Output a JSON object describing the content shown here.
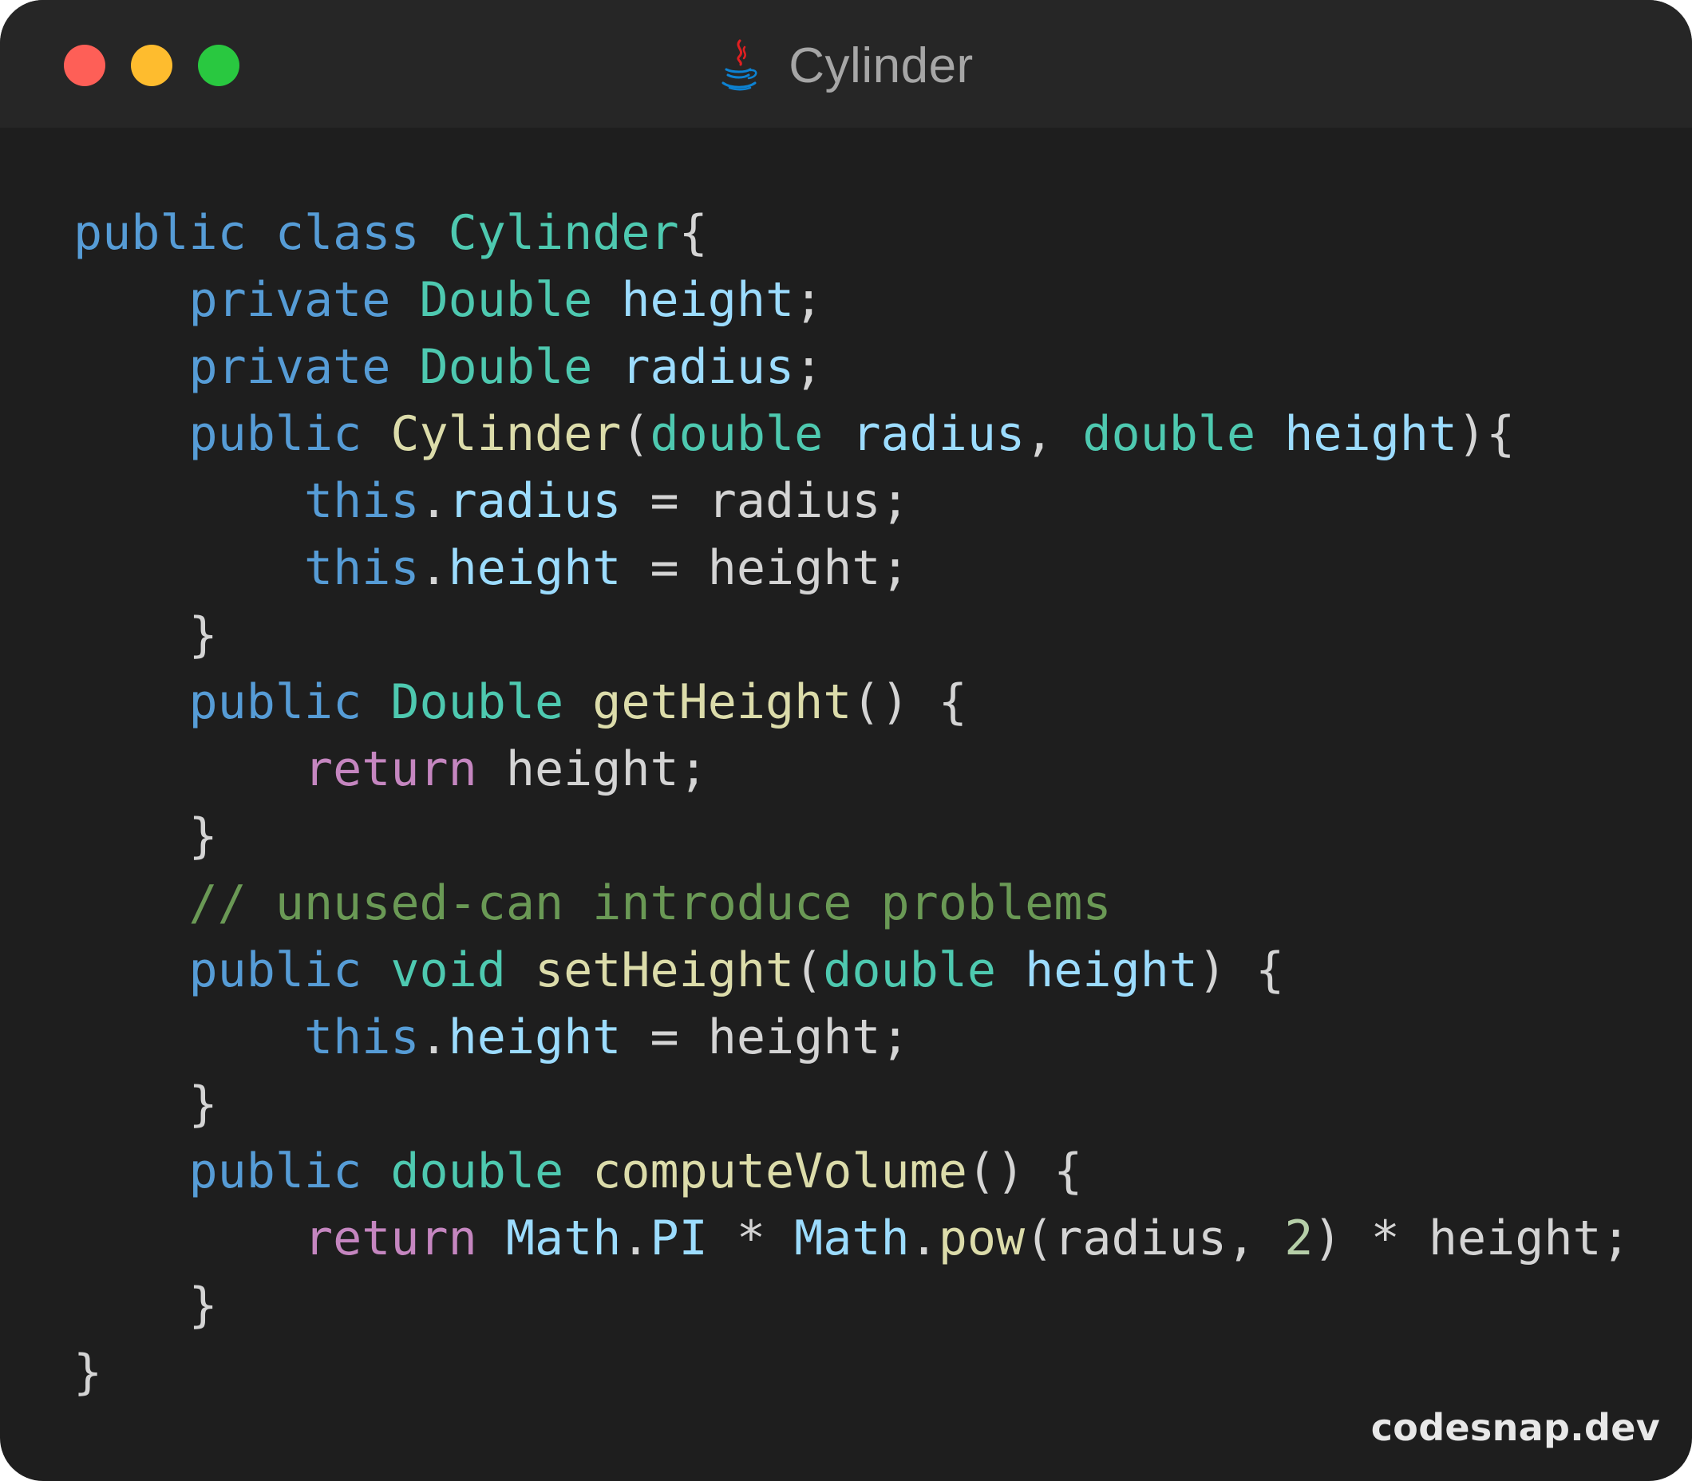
{
  "window": {
    "title": "Cylinder",
    "file_icon": "java-icon",
    "traffic_lights": {
      "close_color": "#fe5f57",
      "minimize_color": "#febc2e",
      "zoom_color": "#29c840"
    }
  },
  "colors": {
    "background": "#1e1e1e",
    "titlebar": "#262626",
    "keyword": "#569cd6",
    "type": "#4ec9b0",
    "variable": "#9cdcfe",
    "function": "#dcdcaa",
    "control": "#c586c0",
    "comment": "#6a9955",
    "number": "#b5cea8",
    "plain": "#d4d4d4"
  },
  "code": {
    "language": "java",
    "lines": [
      [
        {
          "t": "public",
          "k": "kw"
        },
        {
          "t": " ",
          "k": "pl"
        },
        {
          "t": "class",
          "k": "kw"
        },
        {
          "t": " ",
          "k": "pl"
        },
        {
          "t": "Cylinder",
          "k": "type"
        },
        {
          "t": "{",
          "k": "pl"
        }
      ],
      [
        {
          "t": "    ",
          "k": "pl"
        },
        {
          "t": "private",
          "k": "kw"
        },
        {
          "t": " ",
          "k": "pl"
        },
        {
          "t": "Double",
          "k": "type"
        },
        {
          "t": " ",
          "k": "pl"
        },
        {
          "t": "height",
          "k": "var"
        },
        {
          "t": ";",
          "k": "pl"
        }
      ],
      [
        {
          "t": "    ",
          "k": "pl"
        },
        {
          "t": "private",
          "k": "kw"
        },
        {
          "t": " ",
          "k": "pl"
        },
        {
          "t": "Double",
          "k": "type"
        },
        {
          "t": " ",
          "k": "pl"
        },
        {
          "t": "radius",
          "k": "var"
        },
        {
          "t": ";",
          "k": "pl"
        }
      ],
      [
        {
          "t": "    ",
          "k": "pl"
        },
        {
          "t": "public",
          "k": "kw"
        },
        {
          "t": " ",
          "k": "pl"
        },
        {
          "t": "Cylinder",
          "k": "fn"
        },
        {
          "t": "(",
          "k": "pl"
        },
        {
          "t": "double",
          "k": "type"
        },
        {
          "t": " ",
          "k": "pl"
        },
        {
          "t": "radius",
          "k": "var"
        },
        {
          "t": ", ",
          "k": "pl"
        },
        {
          "t": "double",
          "k": "type"
        },
        {
          "t": " ",
          "k": "pl"
        },
        {
          "t": "height",
          "k": "var"
        },
        {
          "t": "){",
          "k": "pl"
        }
      ],
      [
        {
          "t": "        ",
          "k": "pl"
        },
        {
          "t": "this",
          "k": "kw"
        },
        {
          "t": ".",
          "k": "pl"
        },
        {
          "t": "radius",
          "k": "var"
        },
        {
          "t": " = radius;",
          "k": "pl"
        }
      ],
      [
        {
          "t": "        ",
          "k": "pl"
        },
        {
          "t": "this",
          "k": "kw"
        },
        {
          "t": ".",
          "k": "pl"
        },
        {
          "t": "height",
          "k": "var"
        },
        {
          "t": " = height;",
          "k": "pl"
        }
      ],
      [
        {
          "t": "    }",
          "k": "pl"
        }
      ],
      [
        {
          "t": "    ",
          "k": "pl"
        },
        {
          "t": "public",
          "k": "kw"
        },
        {
          "t": " ",
          "k": "pl"
        },
        {
          "t": "Double",
          "k": "type"
        },
        {
          "t": " ",
          "k": "pl"
        },
        {
          "t": "getHeight",
          "k": "fn"
        },
        {
          "t": "() {",
          "k": "pl"
        }
      ],
      [
        {
          "t": "        ",
          "k": "pl"
        },
        {
          "t": "return",
          "k": "ret"
        },
        {
          "t": " height;",
          "k": "pl"
        }
      ],
      [
        {
          "t": "    }",
          "k": "pl"
        }
      ],
      [
        {
          "t": "    ",
          "k": "pl"
        },
        {
          "t": "// unused-can introduce problems",
          "k": "cmt"
        }
      ],
      [
        {
          "t": "    ",
          "k": "pl"
        },
        {
          "t": "public",
          "k": "kw"
        },
        {
          "t": " ",
          "k": "pl"
        },
        {
          "t": "void",
          "k": "type"
        },
        {
          "t": " ",
          "k": "pl"
        },
        {
          "t": "setHeight",
          "k": "fn"
        },
        {
          "t": "(",
          "k": "pl"
        },
        {
          "t": "double",
          "k": "type"
        },
        {
          "t": " ",
          "k": "pl"
        },
        {
          "t": "height",
          "k": "var"
        },
        {
          "t": ") {",
          "k": "pl"
        }
      ],
      [
        {
          "t": "        ",
          "k": "pl"
        },
        {
          "t": "this",
          "k": "kw"
        },
        {
          "t": ".",
          "k": "pl"
        },
        {
          "t": "height",
          "k": "var"
        },
        {
          "t": " = height;",
          "k": "pl"
        }
      ],
      [
        {
          "t": "    }",
          "k": "pl"
        }
      ],
      [
        {
          "t": "    ",
          "k": "pl"
        },
        {
          "t": "public",
          "k": "kw"
        },
        {
          "t": " ",
          "k": "pl"
        },
        {
          "t": "double",
          "k": "type"
        },
        {
          "t": " ",
          "k": "pl"
        },
        {
          "t": "computeVolume",
          "k": "fn"
        },
        {
          "t": "() {",
          "k": "pl"
        }
      ],
      [
        {
          "t": "        ",
          "k": "pl"
        },
        {
          "t": "return",
          "k": "ret"
        },
        {
          "t": " ",
          "k": "pl"
        },
        {
          "t": "Math",
          "k": "var"
        },
        {
          "t": ".",
          "k": "pl"
        },
        {
          "t": "PI",
          "k": "var"
        },
        {
          "t": " * ",
          "k": "pl"
        },
        {
          "t": "Math",
          "k": "var"
        },
        {
          "t": ".",
          "k": "pl"
        },
        {
          "t": "pow",
          "k": "fn"
        },
        {
          "t": "(radius, ",
          "k": "pl"
        },
        {
          "t": "2",
          "k": "num"
        },
        {
          "t": ") * height;",
          "k": "pl"
        }
      ],
      [
        {
          "t": "    }",
          "k": "pl"
        }
      ],
      [
        {
          "t": "}",
          "k": "pl"
        }
      ]
    ]
  },
  "watermark": "codesnap.dev"
}
